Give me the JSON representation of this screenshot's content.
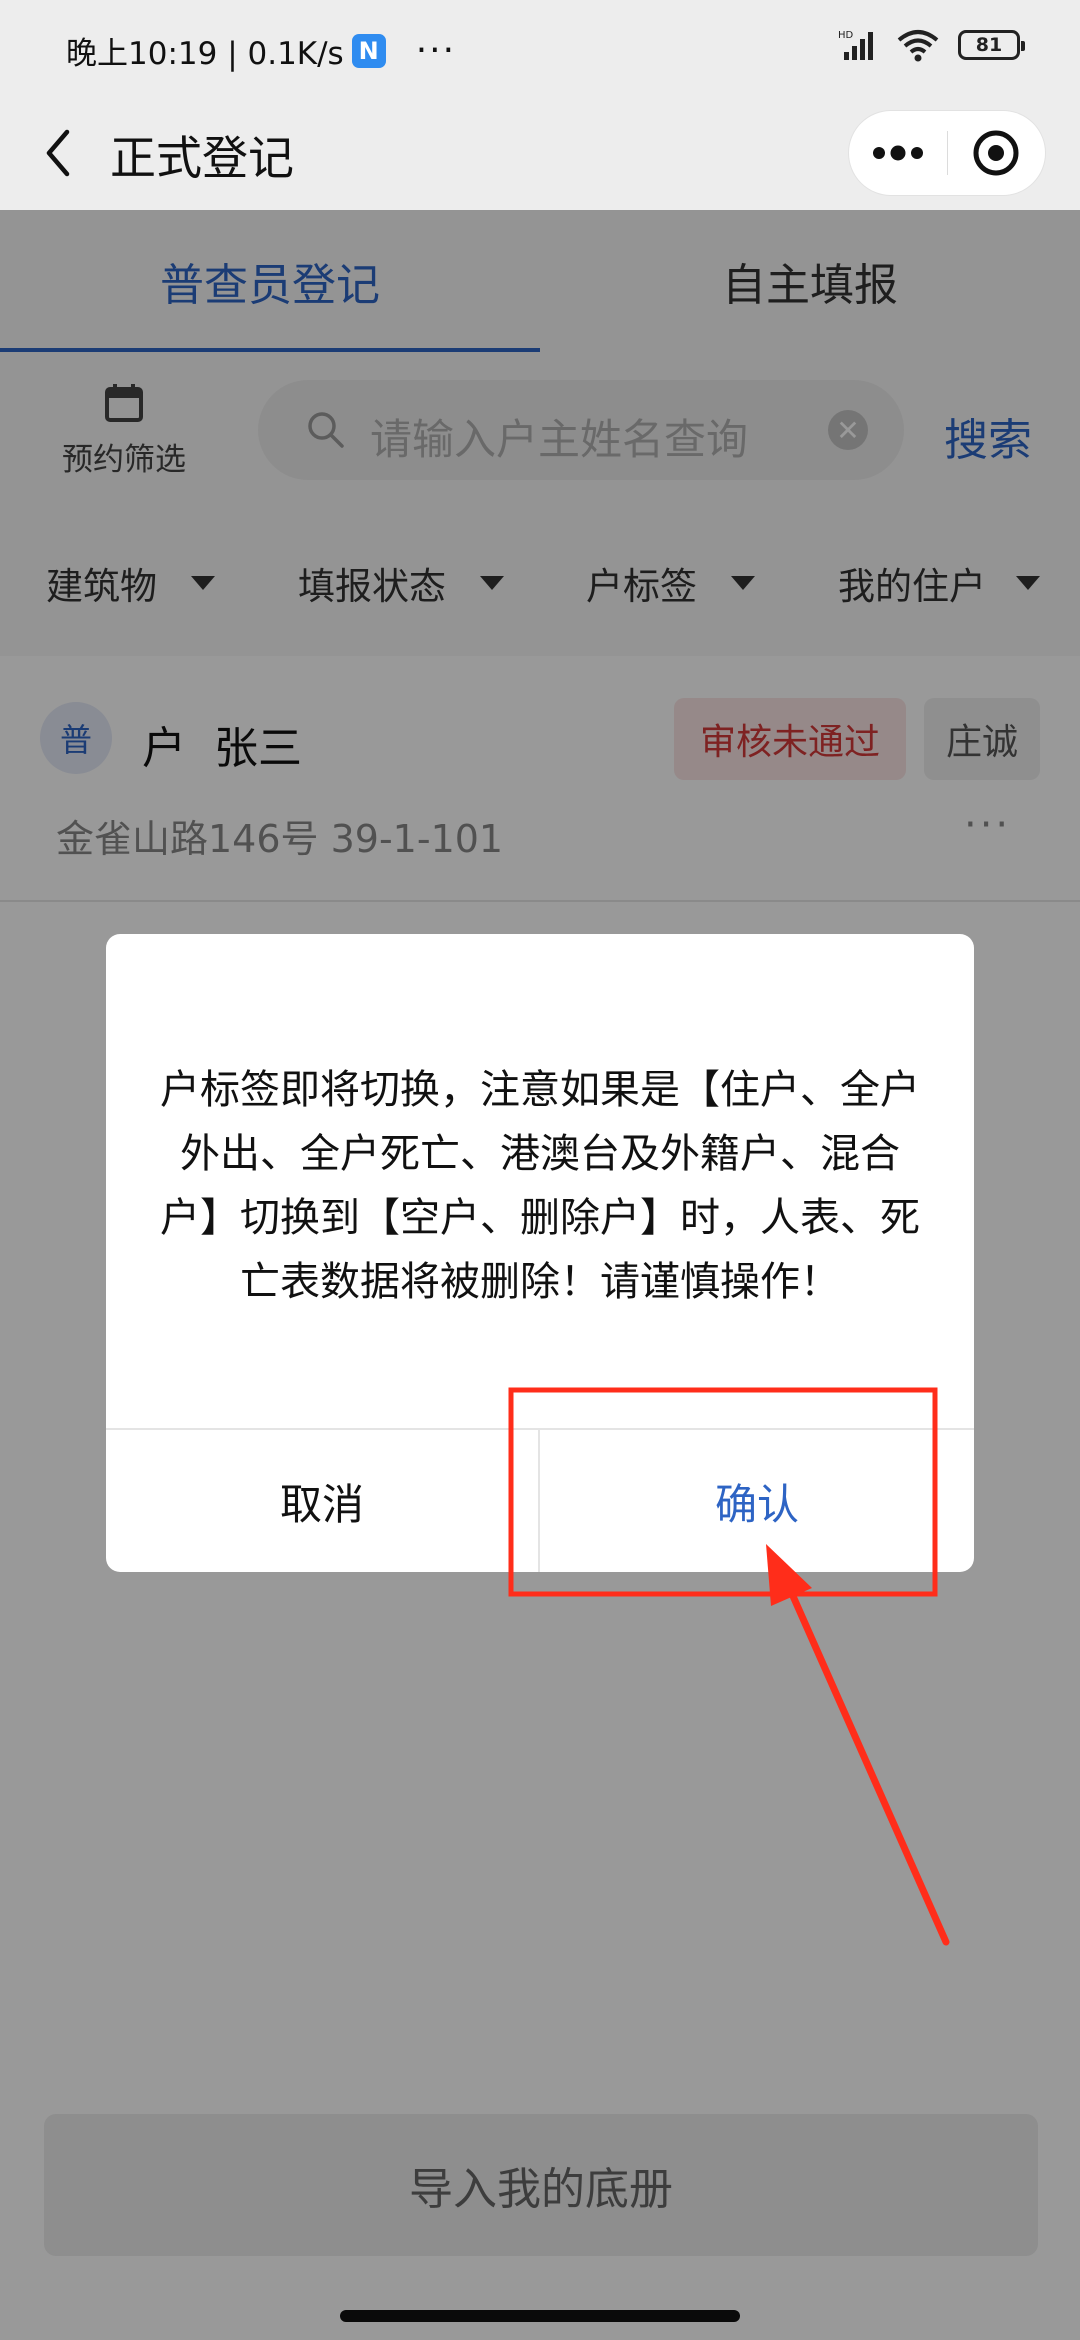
{
  "status_bar": {
    "time_speed": "晚上10:19 | 0.1K/s",
    "app_icon": "N",
    "more": "···",
    "battery": "81"
  },
  "nav": {
    "title": "正式登记"
  },
  "tabs": [
    {
      "label": "普查员登记",
      "active": true
    },
    {
      "label": "自主填报",
      "active": false
    }
  ],
  "toolbar": {
    "appointment_filter_label": "预约筛选",
    "search_placeholder": "请输入户主姓名查询",
    "search_button": "搜索"
  },
  "filters": [
    {
      "label": "建筑物"
    },
    {
      "label": "填报状态"
    },
    {
      "label": "户标签"
    },
    {
      "label": "我的住户"
    }
  ],
  "household": {
    "type_badge": "普",
    "type": "户",
    "name": "张三",
    "status": "审核未通过",
    "officer": "庄诚",
    "address": "金雀山路146号 39-1-101",
    "more": "···"
  },
  "dialog": {
    "message": "户标签即将切换，注意如果是【住户、全户外出、全户死亡、港澳台及外籍户、混合户】切换到【空户、删除户】时，人表、死亡表数据将被删除！请谨慎操作！",
    "cancel": "取消",
    "confirm": "确认"
  },
  "import_button": "导入我的底册",
  "colors": {
    "accent": "#2e64c4",
    "error": "#d33a3a",
    "annotation": "#ff2d1a"
  }
}
